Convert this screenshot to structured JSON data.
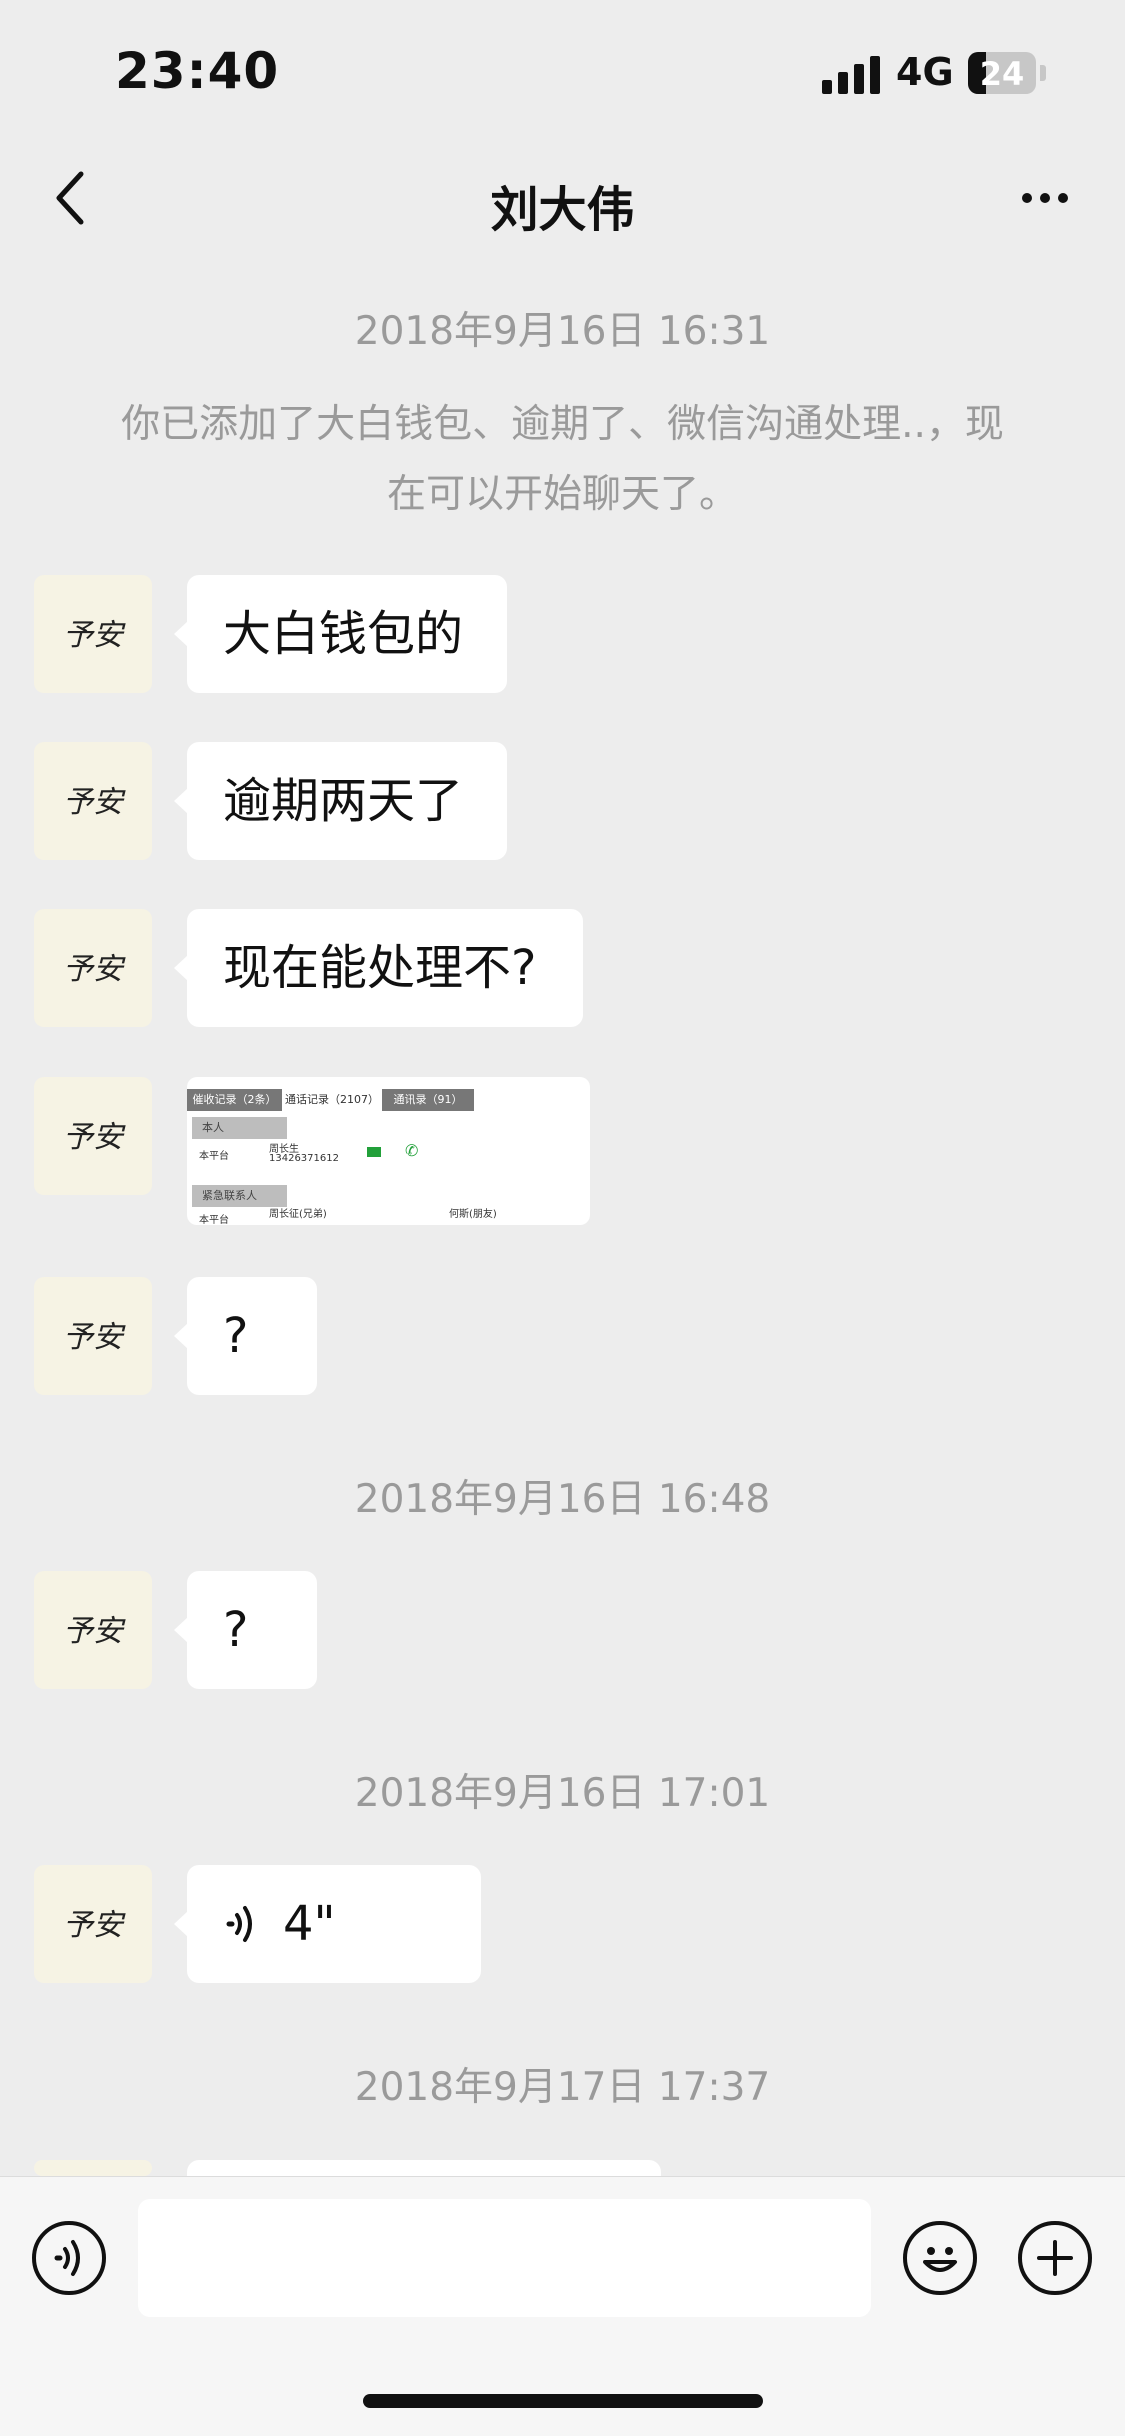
{
  "status_bar": {
    "time": "23:40",
    "network": "4G",
    "battery": "24"
  },
  "nav": {
    "title": "刘大伟",
    "back_icon": "chevron-left-icon",
    "more_icon": "ellipsis-icon"
  },
  "chat": {
    "timestamps": [
      "2018年9月16日 16:31",
      "2018年9月16日 16:48",
      "2018年9月16日 17:01",
      "2018年9月17日 17:37"
    ],
    "system_line1": "你已添加了大白钱包、逾期了、微信沟通处理..，现",
    "system_line2": "在可以开始聊天了。",
    "messages": [
      {
        "type": "text",
        "text": "大白钱包的"
      },
      {
        "type": "text",
        "text": "逾期两天了"
      },
      {
        "type": "text",
        "text": "现在能处理不?"
      },
      {
        "type": "image"
      },
      {
        "type": "text",
        "text": "?"
      },
      {
        "type": "text",
        "text": "?"
      },
      {
        "type": "voice",
        "text": "4\""
      }
    ],
    "image_content": {
      "tabs": [
        "催收记录（2条）",
        "通话记录（2107）",
        "通讯录（91）"
      ],
      "section_self": "本人",
      "section_emergency": "紧急联系人",
      "platform": "本平台",
      "name_self": "周长生",
      "phone_self": "13426371612",
      "name_em1": "周长征(兄弟)",
      "name_em2": "何斯(朋友)"
    }
  },
  "input_bar": {
    "voice_icon": "voice-icon",
    "emoji_icon": "emoji-icon",
    "plus_icon": "plus-icon"
  },
  "avatar": {
    "text": "予安"
  }
}
